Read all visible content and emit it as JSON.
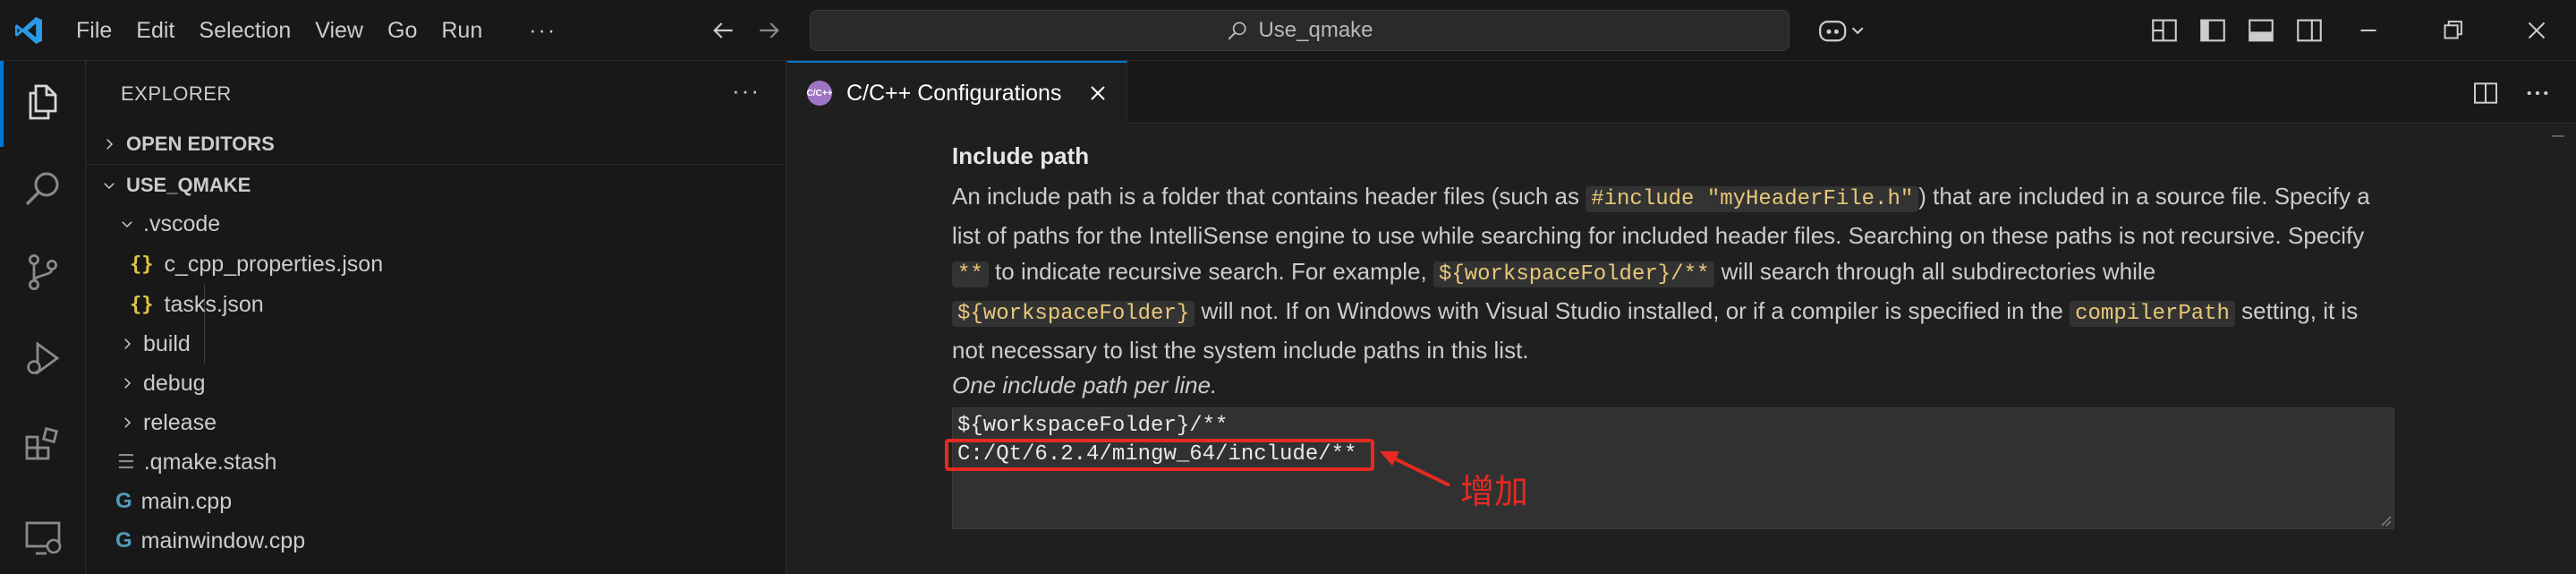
{
  "titlebar": {
    "menu": [
      "File",
      "Edit",
      "Selection",
      "View",
      "Go",
      "Run"
    ],
    "more": "···",
    "search_text": "Use_qmake"
  },
  "sidebar": {
    "title": "EXPLORER",
    "more": "···",
    "open_editors": "OPEN EDITORS",
    "workspace": "USE_QMAKE",
    "tree": [
      {
        "label": ".vscode",
        "type": "folder-open"
      },
      {
        "label": "c_cpp_properties.json",
        "type": "json"
      },
      {
        "label": "tasks.json",
        "type": "json"
      },
      {
        "label": "build",
        "type": "folder"
      },
      {
        "label": "debug",
        "type": "folder"
      },
      {
        "label": "release",
        "type": "folder"
      },
      {
        "label": ".qmake.stash",
        "type": "file"
      },
      {
        "label": "main.cpp",
        "type": "cpp"
      },
      {
        "label": "mainwindow.cpp",
        "type": "cpp"
      }
    ]
  },
  "tab": {
    "label": "C/C++ Configurations",
    "icon_text": "C/C++"
  },
  "setting": {
    "title": "Include path",
    "desc": {
      "t1": "An include path is a folder that contains header files (such as ",
      "c1": "#include \"myHeaderFile.h\"",
      "t2": ") that are included in a source file. Specify a list of paths for the IntelliSense engine to use while searching for included header files. Searching on these paths is not recursive. Specify ",
      "c2": "**",
      "t3": " to indicate recursive search. For example, ",
      "c3": "${workspaceFolder}/**",
      "t4": " will search through all subdirectories while ",
      "c4": "${workspaceFolder}",
      "t5": " will not. If on Windows with Visual Studio installed, or if a compiler is specified in the ",
      "c5": "compilerPath",
      "t6": " setting, it is not necessary to list the system include paths in this list."
    },
    "note": "One include path per line.",
    "lines": [
      "${workspaceFolder}/**",
      "C:/Qt/6.2.4/mingw_64/include/**"
    ]
  },
  "annotation": {
    "text": "增加",
    "color": "#e62a22"
  },
  "colors": {
    "accent": "#0078d4",
    "code_text": "#e8c879",
    "json_icon": "#e2c541",
    "cpp_icon": "#519aba"
  }
}
